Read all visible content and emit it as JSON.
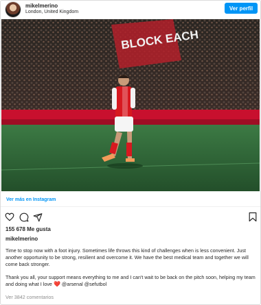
{
  "header": {
    "username": "mikelmerino",
    "location": "London, United Kingdom",
    "profile_button": "Ver perfil"
  },
  "photo": {
    "banner_text": "BLOCK EACH"
  },
  "actions": {
    "view_more": "Ver más en Instagram"
  },
  "likes": "155 678 Me gusta",
  "author": "mikelmerino",
  "caption": {
    "paragraph1": "Time to stop now with a foot injury. Sometimes life throws this kind of challenges when is less convenient. Just another opportunity to be strong, resilient and overcome it. We have the best medical team and together we will come back stronger.",
    "paragraph2_a": "Thank you all, your support means everything to me and I can't wait to be back on the pitch soon, helping my team and doing what I love",
    "heart": "❤️",
    "mention1": "@arsenal",
    "mention2": "@sefutbol"
  },
  "comments": "Ver 3842 comentarios",
  "colors": {
    "accent": "#0095f6",
    "kit_red": "#d71920",
    "pitch": "#2f6a39"
  },
  "icons": [
    "heart-icon",
    "comment-icon",
    "share-icon",
    "bookmark-icon"
  ]
}
